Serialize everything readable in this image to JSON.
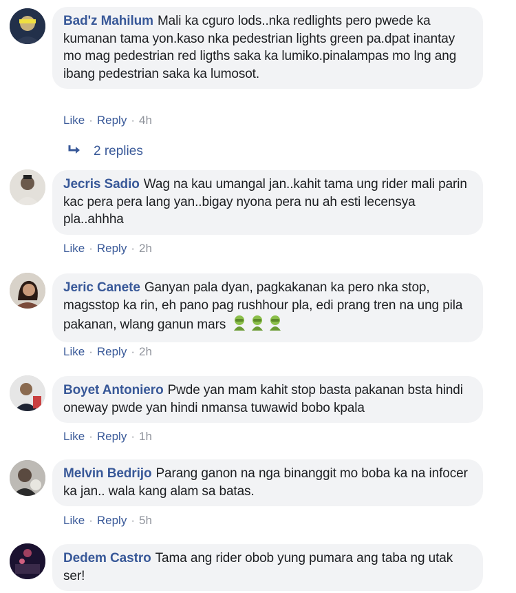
{
  "comments": [
    {
      "author": "Bad'z Mahilum",
      "text": "Mali ka cguro lods..nka redlights pero pwede ka kumanan tama yon.kaso nka pedestrian lights green pa.dpat inantay mo mag pedestrian red ligths saka ka lumiko.pinalampas mo lng ang ibang pedestrian saka ka lumosot.",
      "like": "Like",
      "reply": "Reply",
      "time": "4h",
      "replies": "2 replies"
    },
    {
      "author": "Jecris Sadio",
      "text": "Wag na kau umangal jan..kahit tama ung rider mali parin kac pera pera lang yan..bigay nyona pera nu ah esti lecensya pla..ahhha",
      "like": "Like",
      "reply": "Reply",
      "time": "2h"
    },
    {
      "author": "Jeric Canete",
      "text": "Ganyan pala dyan, pagkakanan ka pero nka stop, magsstop ka rin, eh pano pag rushhour pla, edi prang tren na ung pila pakanan, wlang ganun mars",
      "emoji_name": "facepalm-emoji",
      "like": "Like",
      "reply": "Reply",
      "time": "2h"
    },
    {
      "author": "Boyet Antoniero",
      "text": "Pwde yan mam kahit stop basta pakanan bsta hindi oneway pwde yan hindi nmansa tuwawid bobo kpala",
      "like": "Like",
      "reply": "Reply",
      "time": "1h"
    },
    {
      "author": "Melvin Bedrijo",
      "text": "Parang ganon na nga binanggit mo boba ka na infocer ka jan.. wala kang alam sa batas.",
      "like": "Like",
      "reply": "Reply",
      "time": "5h"
    },
    {
      "author": "Dedem Castro",
      "text": "Tama ang rider obob yung pumara ang taba ng utak ser!"
    }
  ],
  "separator": "·",
  "colors": {
    "link": "#385898",
    "bubble": "#f2f3f5",
    "muted": "#90949c"
  }
}
